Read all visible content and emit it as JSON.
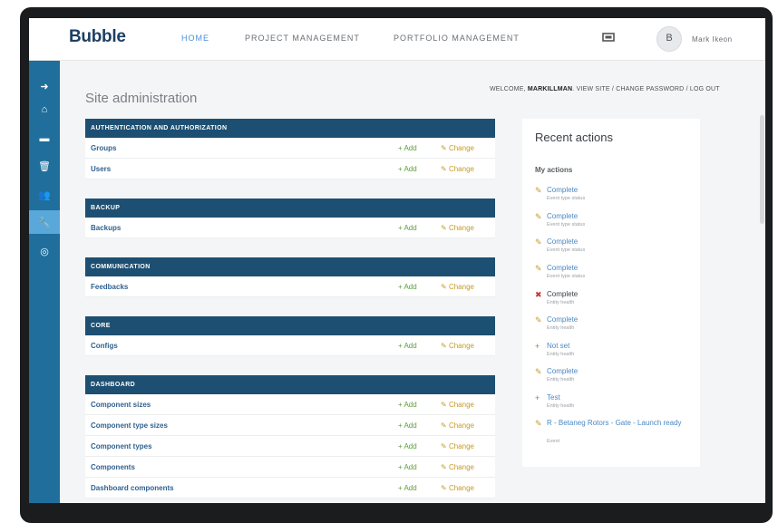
{
  "app": {
    "logo": "Bubble",
    "nav": [
      {
        "label": "HOME",
        "active": true
      },
      {
        "label": "PROJECT MANAGEMENT",
        "active": false
      },
      {
        "label": "PORTFOLIO MANAGEMENT",
        "active": false
      }
    ],
    "avatar_letter": "B",
    "user_name": "Mark Ikeon"
  },
  "sidebar": {
    "items": [
      {
        "icon": "arrow-right-icon",
        "glyph": "➜"
      },
      {
        "icon": "home-icon",
        "glyph": "⌂"
      },
      {
        "icon": "message-icon",
        "glyph": "▬"
      },
      {
        "icon": "trash-icon",
        "glyph": "🗑"
      },
      {
        "icon": "users-icon",
        "glyph": "👥"
      },
      {
        "icon": "wrench-icon",
        "glyph": "🔧",
        "active": true
      },
      {
        "icon": "settings-circle-icon",
        "glyph": "◎"
      }
    ]
  },
  "page": {
    "title": "Site administration",
    "welcome_prefix": "WELCOME, ",
    "welcome_user": "MARKILLMAN",
    "welcome_links": ". VIEW SITE / CHANGE PASSWORD / LOG OUT"
  },
  "labels": {
    "add": "Add",
    "change": "Change"
  },
  "modules": [
    {
      "header": "AUTHENTICATION AND AUTHORIZATION",
      "rows": [
        "Groups",
        "Users"
      ]
    },
    {
      "header": "BACKUP",
      "rows": [
        "Backups"
      ]
    },
    {
      "header": "COMMUNICATION",
      "rows": [
        "Feedbacks"
      ]
    },
    {
      "header": "CORE",
      "rows": [
        "Configs"
      ]
    },
    {
      "header": "DASHBOARD",
      "rows": [
        "Component sizes",
        "Component type sizes",
        "Component types",
        "Components",
        "Dashboard components"
      ]
    }
  ],
  "recent": {
    "title": "Recent actions",
    "subtitle": "My actions",
    "actions": [
      {
        "type": "change",
        "title": "Complete",
        "sub": "Event type status"
      },
      {
        "type": "change",
        "title": "Complete",
        "sub": "Event type status"
      },
      {
        "type": "change",
        "title": "Complete",
        "sub": "Event type status"
      },
      {
        "type": "change",
        "title": "Complete",
        "sub": "Event type status"
      },
      {
        "type": "delete",
        "title": "Complete",
        "sub": "Entity health"
      },
      {
        "type": "change",
        "title": "Complete",
        "sub": "Entity health"
      },
      {
        "type": "add",
        "title": "Not set",
        "sub": "Entity health"
      },
      {
        "type": "change",
        "title": "Complete",
        "sub": "Entity health"
      },
      {
        "type": "add",
        "title": "Test",
        "sub": "Entity health"
      },
      {
        "type": "change",
        "title": "R - Betaneg Rotors - Gate - Launch ready",
        "sub": "Event"
      }
    ]
  },
  "colors": {
    "sidebar": "#1f6e9c",
    "module_header": "#1d4f72",
    "link": "#31618f",
    "add": "#5f9d3d",
    "change": "#c69a25",
    "delete": "#cc3333"
  }
}
